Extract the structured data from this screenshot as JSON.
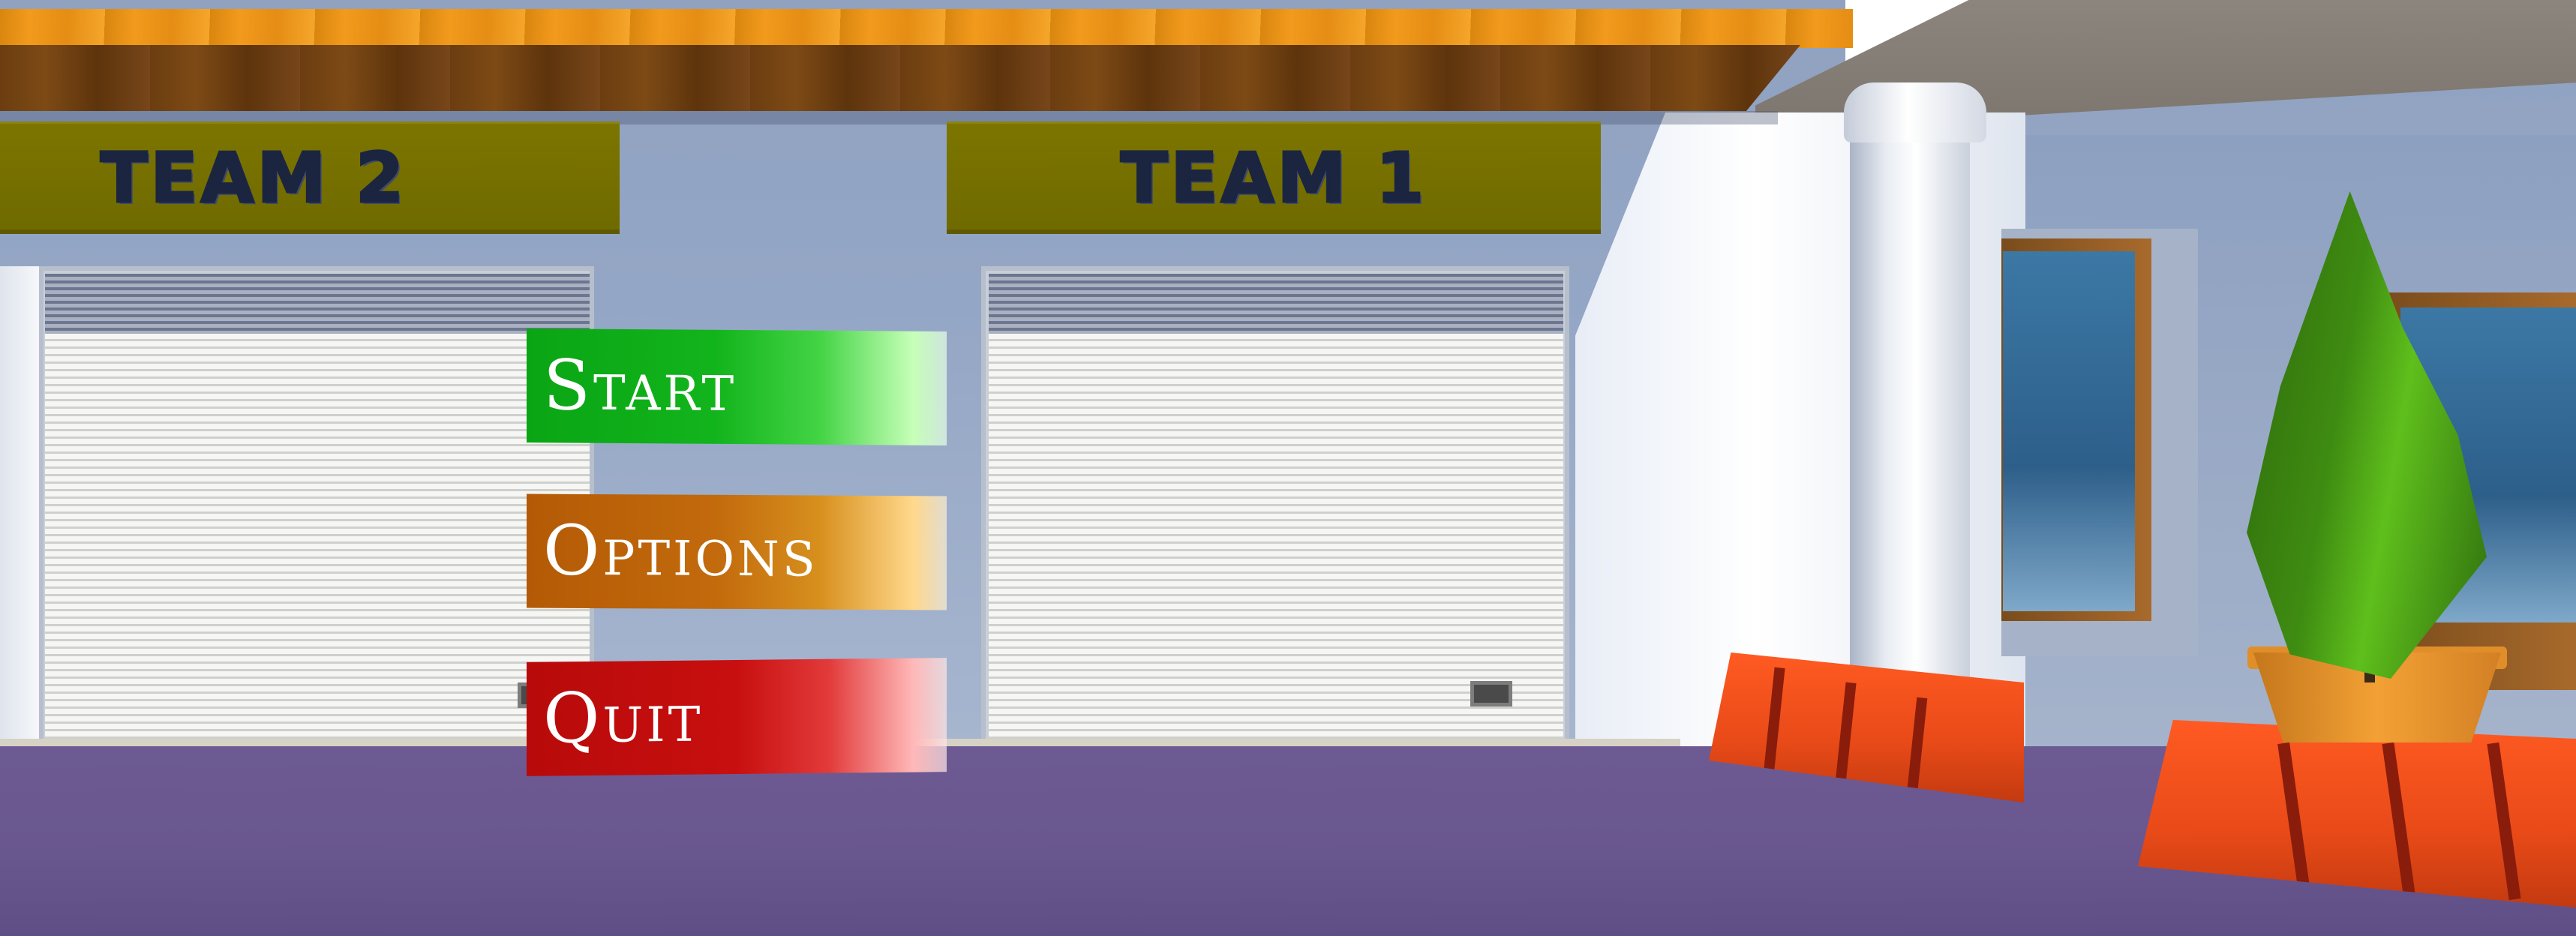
{
  "scene": {
    "sign_left": "TEAM 2",
    "sign_right": "TEAM 1"
  },
  "menu": {
    "start_label": "Start",
    "options_label": "Options",
    "quit_label": "Quit"
  },
  "colors": {
    "start": "#0aa514",
    "options": "#b45a06",
    "quit": "#b80a0a",
    "sign": "#7c7500",
    "ground": "#6a5790"
  }
}
